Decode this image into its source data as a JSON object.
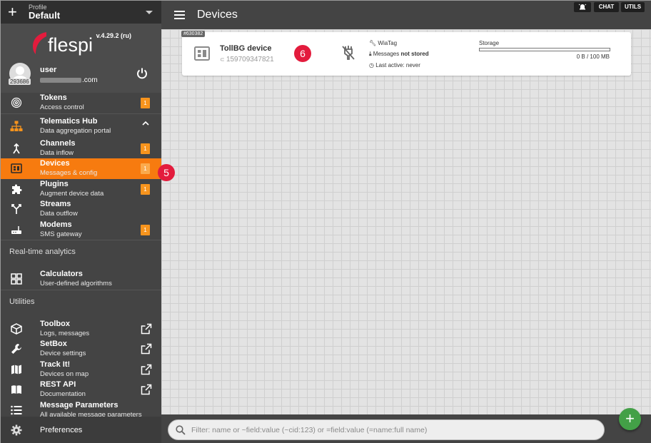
{
  "profile": {
    "label": "Profile",
    "name": "Default"
  },
  "brand": {
    "logo_text": "flespi",
    "version": "v.4.29.2 (ru)",
    "accent": "#e31c3d"
  },
  "user": {
    "id": "293686",
    "name": "user",
    "email_suffix": ".com"
  },
  "nav": {
    "tokens": {
      "title": "Tokens",
      "subtitle": "Access control",
      "badge": "1"
    },
    "hub": {
      "title": "Telematics Hub",
      "subtitle": "Data aggregation portal"
    },
    "channels": {
      "title": "Channels",
      "subtitle": "Data inflow",
      "badge": "1"
    },
    "devices": {
      "title": "Devices",
      "subtitle": "Messages & config",
      "badge": "1"
    },
    "plugins": {
      "title": "Plugins",
      "subtitle": "Augment device data",
      "badge": "1"
    },
    "streams": {
      "title": "Streams",
      "subtitle": "Data outflow"
    },
    "modems": {
      "title": "Modems",
      "subtitle": "SMS gateway",
      "badge": "1"
    },
    "analytics_section": "Real-time analytics",
    "calculators": {
      "title": "Calculators",
      "subtitle": "User-defined algorithms"
    },
    "utilities_section": "Utilities",
    "toolbox": {
      "title": "Toolbox",
      "subtitle": "Logs, messages"
    },
    "setbox": {
      "title": "SetBox",
      "subtitle": "Device settings"
    },
    "trackit": {
      "title": "Track It!",
      "subtitle": "Devices on map"
    },
    "restapi": {
      "title": "REST API",
      "subtitle": "Documentation"
    },
    "msgparams": {
      "title": "Message Parameters",
      "subtitle": "All available message parameters"
    },
    "preferences": "Preferences"
  },
  "header": {
    "title": "Devices",
    "chat_label": "CHAT",
    "utils_label": "UTILS"
  },
  "device_card": {
    "id_tag": "#630382",
    "name": "TollBG device",
    "ident": "159709347821",
    "marker": "6",
    "device_type": "WiaTag",
    "messages_prefix": "Messages",
    "messages_status": "not stored",
    "last_active": "Last active: never",
    "storage_label": "Storage",
    "storage_value": "0 B / 100 MB",
    "storage_fraction": 0
  },
  "marker5": "5",
  "filter": {
    "placeholder": "Filter: name or ~field:value (~cid:123) or =field:value (=name:full name)"
  },
  "fab_label": "+",
  "colors": {
    "sidebar": "#444444",
    "active": "#f77b0f",
    "badge": "#f7941d",
    "fab": "#43a047"
  }
}
